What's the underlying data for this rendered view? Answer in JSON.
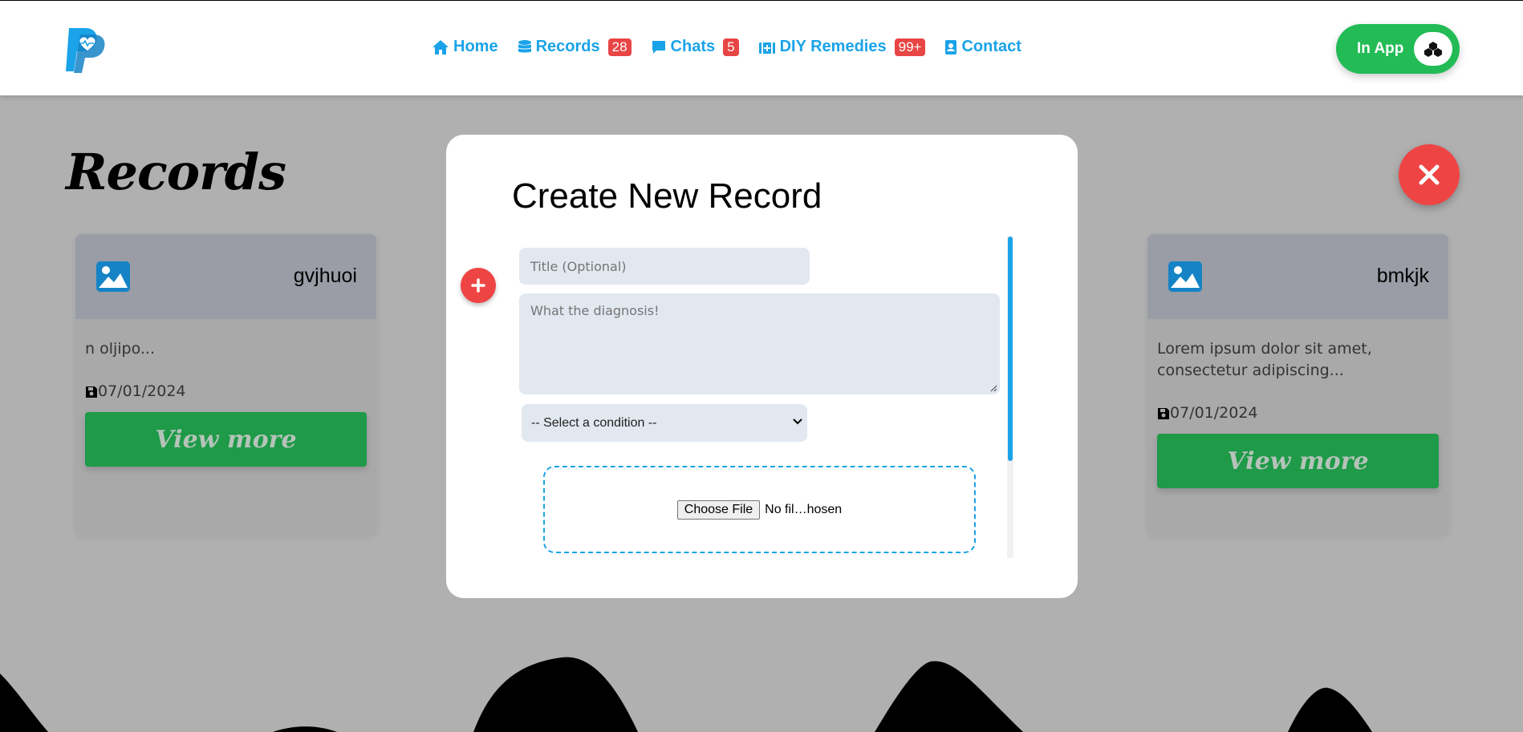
{
  "header": {
    "logo_icon": "pp-heartbeat-logo-icon",
    "nav": [
      {
        "label": "Home",
        "icon": "home-icon",
        "badge": ""
      },
      {
        "label": "Records",
        "icon": "database-icon",
        "badge": "28"
      },
      {
        "label": "Chats",
        "icon": "chat-bubble-icon",
        "badge": "5"
      },
      {
        "label": "DIY Remedies",
        "icon": "first-aid-kit-icon",
        "badge": "99+"
      },
      {
        "label": "Contact",
        "icon": "contact-card-icon",
        "badge": ""
      }
    ],
    "in_app_label": "In App",
    "in_app_icon": "cubes-icon"
  },
  "page": {
    "title": "Records",
    "cards": [
      {
        "title": "gvjhuoi",
        "snippet": "n oljipo...",
        "date": "07/01/2024",
        "button": "View more"
      },
      {
        "title": "bmkjk",
        "snippet": "Lorem ipsum dolor sit amet, consectetur adipiscing...",
        "date": "07/01/2024",
        "button": "View more"
      }
    ]
  },
  "modal": {
    "title": "Create New Record",
    "title_placeholder": "Title (Optional)",
    "diagnosis_placeholder": "What the diagnosis!",
    "condition_selected": "-- Select a condition --",
    "file_button": "Choose File",
    "file_status": "No fil…hosen"
  },
  "colors": {
    "accent": "#1aa3e8",
    "danger": "#ef4444",
    "success": "#22bb55",
    "overlay": "#b0b0b0"
  }
}
